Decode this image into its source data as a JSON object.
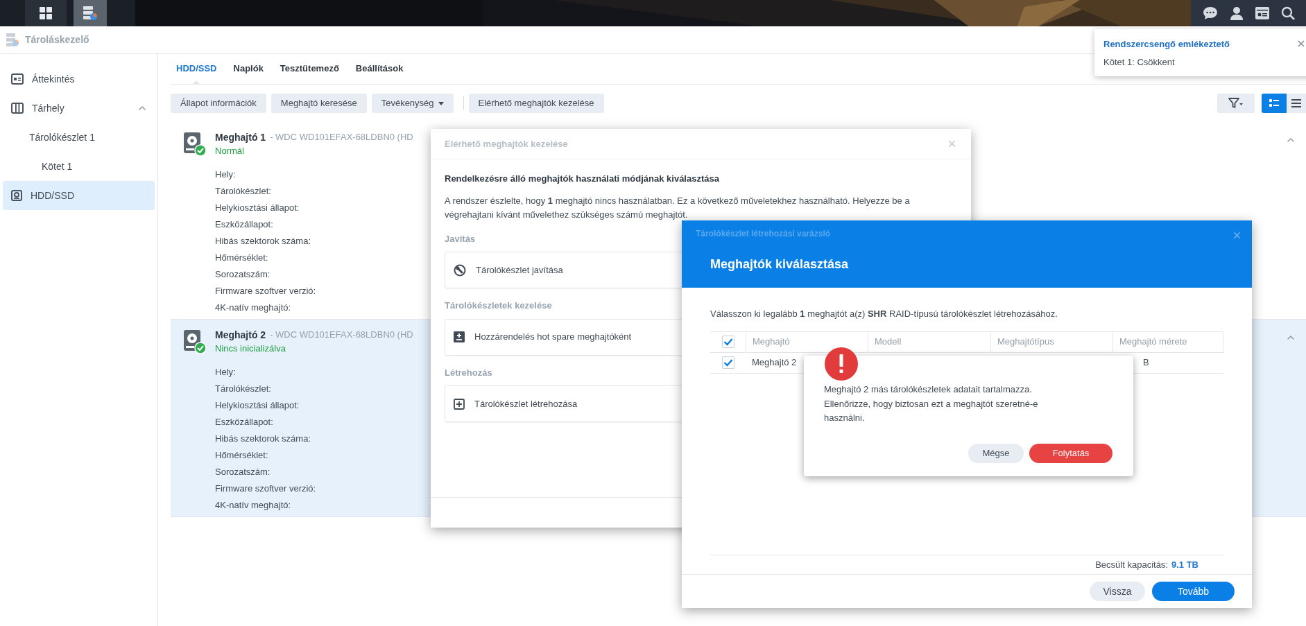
{
  "taskbar": {
    "buttons": [
      {
        "kind": "main-menu",
        "selected": false
      },
      {
        "kind": "storage-app",
        "selected": true
      }
    ]
  },
  "app": {
    "title": "Tároláskezelő"
  },
  "sidebar": {
    "items": [
      {
        "label": "Áttekintés",
        "kind": "overview",
        "selected": false
      },
      {
        "label": "Tárhely",
        "kind": "storage",
        "selected": false,
        "expanded": true,
        "children": [
          {
            "label": "Tárolókészlet 1",
            "selected": false,
            "children": [
              {
                "label": "Kötet 1",
                "selected": false
              }
            ]
          }
        ]
      },
      {
        "label": "HDD/SSD",
        "kind": "hdd",
        "selected": true
      }
    ]
  },
  "tabs": [
    {
      "label": "HDD/SSD",
      "selected": true
    },
    {
      "label": "Naplók",
      "selected": false
    },
    {
      "label": "Tesztütemező",
      "selected": false
    },
    {
      "label": "Beállítások",
      "selected": false
    }
  ],
  "toolbar": {
    "groups": [
      [
        {
          "label": "Állapot információk",
          "kind": "button"
        },
        {
          "label": "Meghajtó keresése",
          "kind": "button"
        },
        {
          "label": "Tevékenység",
          "kind": "dropdown"
        }
      ],
      [
        {
          "label": "Elérhető meghajtók kezelése",
          "kind": "button"
        }
      ]
    ],
    "view_buttons": [
      {
        "kind": "filter",
        "selected": false
      },
      {
        "kind": "detail",
        "selected": true
      },
      {
        "kind": "list",
        "selected": false
      }
    ]
  },
  "drives": [
    {
      "name": "Meghajtó 1",
      "model": "- WDC WD101EFAX-68LDBN0 (HD",
      "status": "Normál",
      "selected": false,
      "expanded": true,
      "fields": [
        "Hely:",
        "Tárolókészlet:",
        "Helykiosztási állapot:",
        "Eszközállapot:",
        "Hibás szektorok száma:",
        "Hőmérséklet:",
        "Sorozatszám:",
        "Firmware szoftver verzió:",
        "4K-natív meghajtó:"
      ]
    },
    {
      "name": "Meghajtó 2",
      "model": "- WDC WD101EFAX-68LDBN0 (HD",
      "status": "Nincs inicializálva",
      "selected": true,
      "expanded": true,
      "fields": [
        "Hely:",
        "Tárolókészlet:",
        "Helykiosztási állapot:",
        "Eszközállapot:",
        "Hibás szektorok száma:",
        "Hőmérséklet:",
        "Sorozatszám:",
        "Firmware szoftver verzió:",
        "4K-natív meghajtó:"
      ]
    }
  ],
  "notification": {
    "title": "Rendszercsengő emlékeztető",
    "message": "Kötet 1: Csökkent"
  },
  "drive_dialog": {
    "title": "Elérhető meghajtók kezelése",
    "heading": "Rendelkezésre álló meghajtók használati módjának kiválasztása",
    "text": "A rendszer észlelte, hogy **1** meghajtó nincs használatban. Ez a következő műveletekhez használható. Helyezze be a végrehajtani kívánt művelethez szükséges számú meghajtót.",
    "sections": [
      {
        "title": "Javítás",
        "options": [
          {
            "label": "Tárolókészlet javítása",
            "kind": "repair"
          }
        ]
      },
      {
        "title": "Tárolókészletek kezelése",
        "options": [
          {
            "label": "Hozzárendelés hot spare meghajtóként",
            "kind": "assign"
          }
        ]
      },
      {
        "title": "Létrehozás",
        "options": [
          {
            "label": "Tárolókészlet létrehozása",
            "kind": "create"
          }
        ]
      }
    ]
  },
  "wizard": {
    "title": "Tárolókészlet létrehozási varázsló",
    "step_title": "Meghajtók kiválasztása",
    "instruction": "Válasszon ki legalább **1** meghajtót a(z) **SHR** RAID-típusú tárolókészlet létrehozásához.",
    "columns": [
      "Meghajtó",
      "Modell",
      "Meghajtótípus",
      "Meghajtó mérete"
    ],
    "all_checked": true,
    "rows": [
      {
        "checked": true,
        "drive": "Meghajtó 2",
        "size": "B"
      }
    ],
    "capacity_label": "Becsült kapacitás:",
    "capacity": "9.1 TB",
    "buttons": [
      {
        "label": "Vissza",
        "kind": "secondary"
      },
      {
        "label": "Tovább",
        "kind": "primary"
      }
    ]
  },
  "alert": {
    "message": "Meghajtó 2 más tárolókészletek adatait tartalmazza. Ellenőrizze, hogy biztosan ezt a meghajtót szeretné-e használni.",
    "buttons": [
      {
        "label": "Mégse",
        "kind": "secondary"
      },
      {
        "label": "Folytatás",
        "kind": "danger"
      }
    ]
  }
}
